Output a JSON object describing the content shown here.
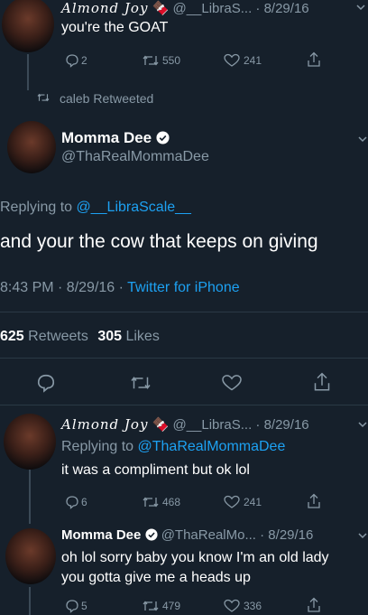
{
  "tweet1": {
    "display_name": "Almond Joy",
    "emoji": "🍫",
    "handle": "@__LibraS...",
    "time": "· 8/29/16",
    "text": "you're the GOAT",
    "replies": "2",
    "retweets": "550",
    "likes": "241"
  },
  "retweet_notice": "caleb Retweeted",
  "main_tweet": {
    "display_name": "Momma Dee",
    "handle": "@ThaRealMommaDee",
    "replying_prefix": "Replying to ",
    "replying_handle": "@__LibraScale__",
    "text": "and your the cow that keeps on giving",
    "time": "8:43 PM · 8/29/16 ·",
    "source": "Twitter for iPhone",
    "retweet_count": "625",
    "retweet_label": "Retweets",
    "like_count": "305",
    "like_label": "Likes"
  },
  "reply1": {
    "display_name": "Almond Joy",
    "emoji": "🍫",
    "handle": "@__LibraS...",
    "time": "· 8/29/16",
    "replying_prefix": "Replying to ",
    "replying_handle": "@ThaRealMommaDee",
    "text": "it was a compliment but ok lol",
    "replies": "6",
    "retweets": "468",
    "likes": "241"
  },
  "reply2": {
    "display_name": "Momma Dee",
    "handle": "@ThaRealMo...",
    "time": "· 8/29/16",
    "text_line1": "oh lol sorry baby you know I'm an old lady",
    "text_line2": "you gotta give me a heads up",
    "replies": "5",
    "retweets": "479",
    "likes": "336"
  },
  "colors": {
    "background": "#16202b",
    "muted": "#8899a6",
    "link": "#1da1f2",
    "verified": "#1da1f2"
  }
}
